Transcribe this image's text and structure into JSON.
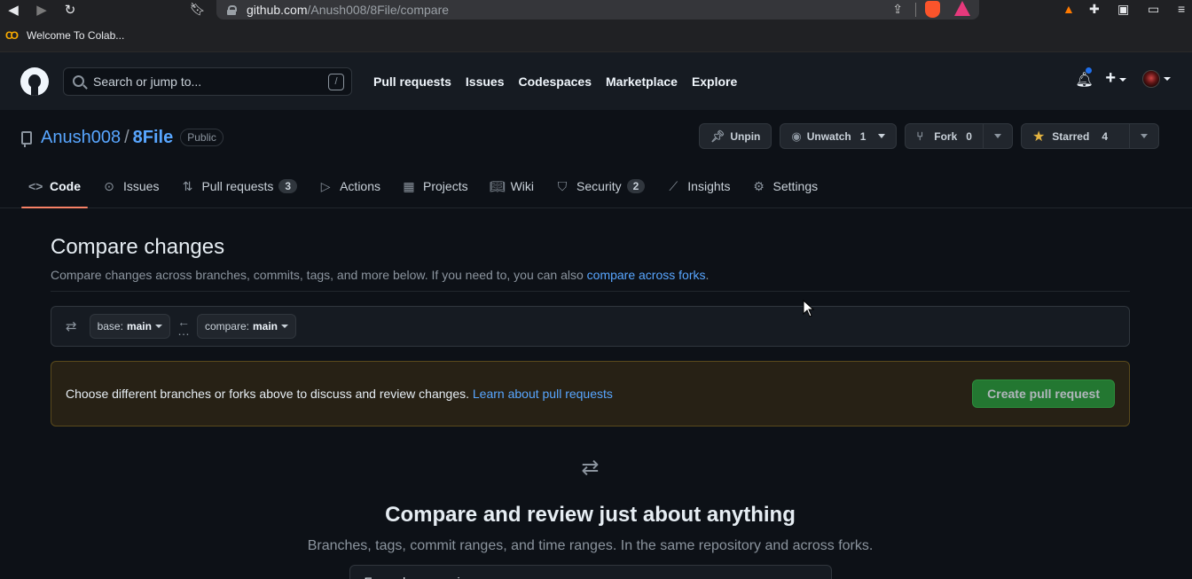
{
  "browser": {
    "url_host": "github.com",
    "url_path": "/Anush008/8File/compare",
    "bookmark_label": "Welcome To Colab..."
  },
  "header": {
    "search_placeholder": "Search or jump to...",
    "search_shortcut": "/",
    "nav": [
      "Pull requests",
      "Issues",
      "Codespaces",
      "Marketplace",
      "Explore"
    ]
  },
  "repo": {
    "owner": "Anush008",
    "separator": "/",
    "name": "8File",
    "visibility": "Public",
    "unpin_label": "Unpin",
    "unwatch_label": "Unwatch",
    "unwatch_count": "1",
    "fork_label": "Fork",
    "fork_count": "0",
    "starred_label": "Starred",
    "starred_count": "4"
  },
  "tabs": [
    {
      "label": "Code",
      "counter": ""
    },
    {
      "label": "Issues",
      "counter": ""
    },
    {
      "label": "Pull requests",
      "counter": "3"
    },
    {
      "label": "Actions",
      "counter": ""
    },
    {
      "label": "Projects",
      "counter": ""
    },
    {
      "label": "Wiki",
      "counter": ""
    },
    {
      "label": "Security",
      "counter": "2"
    },
    {
      "label": "Insights",
      "counter": ""
    },
    {
      "label": "Settings",
      "counter": ""
    }
  ],
  "compare": {
    "title": "Compare changes",
    "desc_prefix": "Compare changes across branches, commits, tags, and more below. If you need to, you can also ",
    "desc_link": "compare across forks",
    "desc_suffix": ".",
    "base_label": "base:",
    "base_value": "main",
    "compare_label": "compare:",
    "compare_value": "main",
    "notice_text": "Choose different branches or forks above to discuss and review changes. ",
    "notice_link": "Learn about pull requests",
    "create_button": "Create pull request",
    "blank_title": "Compare and review just about anything",
    "blank_sub": "Branches, tags, commit ranges, and time ranges. In the same repository and across forks.",
    "examples_label": "Example comparisons"
  },
  "colors": {
    "accent_link": "#58a6ff",
    "tab_underline": "#f78166",
    "create_button_bg": "#238636",
    "notice_border": "#5a4a1c"
  }
}
